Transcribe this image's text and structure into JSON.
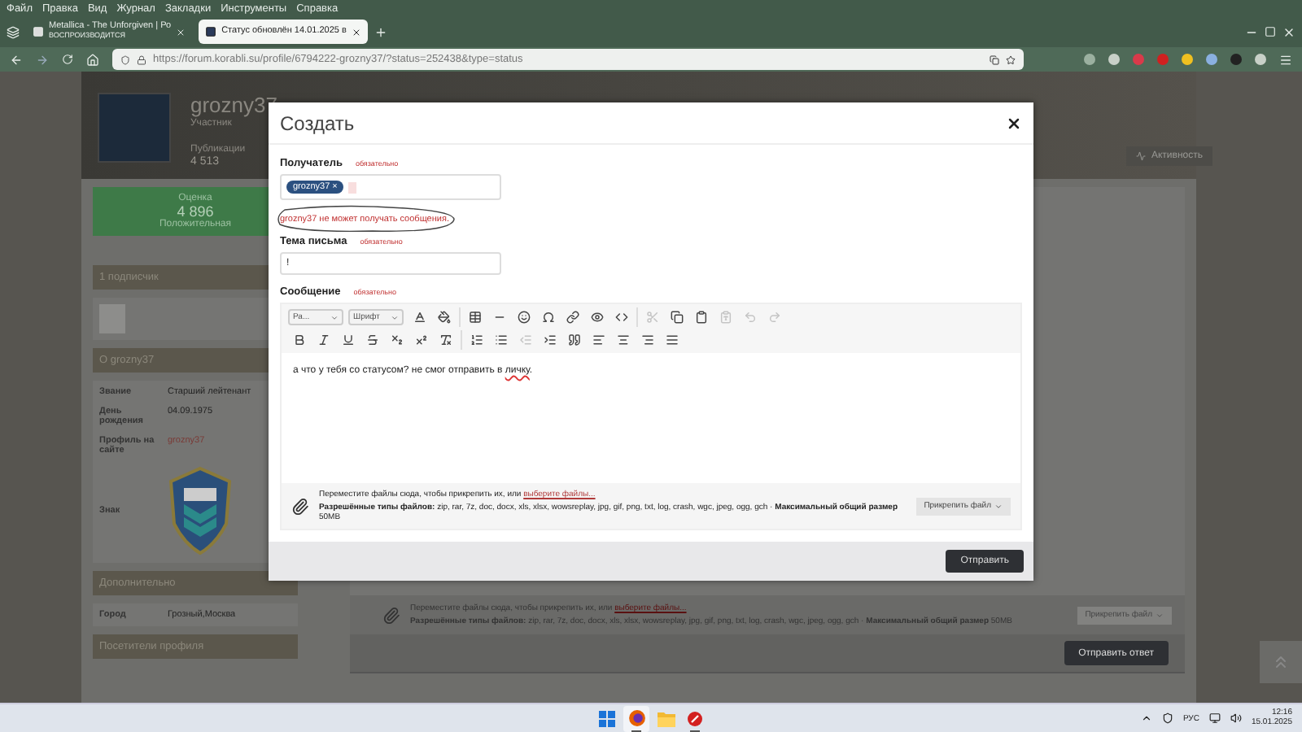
{
  "browser": {
    "menu": [
      "Файл",
      "Правка",
      "Вид",
      "Журнал",
      "Закладки",
      "Инструменты",
      "Справка"
    ],
    "tabs": [
      {
        "title": "Metallica - The Unforgiven | Ро",
        "subtitle": "ВОСПРОИЗВОДИТСЯ",
        "selected": false
      },
      {
        "title": "Статус обновлён 14.01.2025 в",
        "selected": true
      }
    ],
    "url": "https://forum.korabli.su/profile/6794222-grozny37/?status=252438&type=status"
  },
  "profile": {
    "name": "grozny37",
    "role": "Участник",
    "stat_label": "Публикации",
    "stat_value": "4 513",
    "reputation": {
      "label": "Оценка",
      "value": "4 896",
      "verdict": "Положительная"
    },
    "followers_title": "1 подписчик",
    "about_title": "О grozny37",
    "about": [
      {
        "kind": "text",
        "label": "Звание",
        "value": "Старший лейтенант"
      },
      {
        "kind": "text",
        "label": "День рождения",
        "value": "04.09.1975"
      },
      {
        "kind": "link",
        "label": "Профиль на сайте",
        "value": "grozny37"
      },
      {
        "kind": "badge",
        "label": "Знак"
      }
    ],
    "extra_title": "Дополнительно",
    "extra": [
      {
        "label": "Город",
        "value": "Грозный,Москва"
      }
    ],
    "visitors_title": "Посетители профиля",
    "activity_button": "Активность",
    "reply_attach": {
      "text": "Переместите файлы сюда, чтобы прикрепить их, или ",
      "link": "выберите файлы...",
      "types": "**Разрешённые типы файлов:** zip, rar, 7z, doc, docx, xls, xlsx, wowsreplay, jpg, gif, png, txt, log, crash, wgc, jpeg, ogg, gch · **Максимальный общий размер** 50MB",
      "button": "Прикрепить файл"
    },
    "reply_button": "Отправить ответ"
  },
  "modal": {
    "title": "Создать",
    "recipient": {
      "label": "Получатель",
      "required": "обязательно",
      "chip": "grozny37 ×",
      "error": "grozny37 не может получать сообщения."
    },
    "subject": {
      "label": "Тема письма",
      "required": "обязательно",
      "value": "!"
    },
    "message": {
      "label": "Сообщение",
      "required": "обязательно",
      "body": "а что у тебя со статусом? не смог отправить в ",
      "body_misspelled": "личку",
      "body_end": "."
    },
    "toolbar": [
      [
        [
          {
            "kind": "dropdown",
            "label": "Ра..."
          },
          {
            "kind": "dropdown",
            "label": "Шрифт"
          },
          {
            "kind": "text-color",
            "disabled": false
          },
          {
            "kind": "bg-color",
            "disabled": false
          }
        ],
        [
          {
            "kind": "table",
            "disabled": false
          },
          {
            "kind": "rule",
            "disabled": false
          },
          {
            "kind": "emoji",
            "disabled": false
          },
          {
            "kind": "omega",
            "disabled": false
          },
          {
            "kind": "link",
            "disabled": false
          },
          {
            "kind": "preview",
            "disabled": false
          },
          {
            "kind": "source",
            "disabled": false
          }
        ],
        [
          {
            "kind": "cut",
            "disabled": true
          },
          {
            "kind": "copy",
            "disabled": false
          },
          {
            "kind": "paste",
            "disabled": false
          },
          {
            "kind": "paste-text",
            "disabled": true
          },
          {
            "kind": "undo",
            "disabled": true
          },
          {
            "kind": "redo",
            "disabled": true
          }
        ]
      ],
      [
        [
          {
            "kind": "bold",
            "disabled": false
          },
          {
            "kind": "italic",
            "disabled": false
          },
          {
            "kind": "underline",
            "disabled": false
          },
          {
            "kind": "strike",
            "disabled": false
          },
          {
            "kind": "subscript",
            "disabled": false
          },
          {
            "kind": "superscript",
            "disabled": false
          },
          {
            "kind": "clear",
            "disabled": false
          }
        ],
        [
          {
            "kind": "numbered",
            "disabled": false
          },
          {
            "kind": "bulleted",
            "disabled": false
          },
          {
            "kind": "outdent",
            "disabled": true
          },
          {
            "kind": "indent",
            "disabled": false
          },
          {
            "kind": "quote",
            "disabled": false
          },
          {
            "kind": "align-left",
            "disabled": false
          },
          {
            "kind": "align-center",
            "disabled": false
          },
          {
            "kind": "align-right",
            "disabled": false
          },
          {
            "kind": "justify",
            "disabled": false
          }
        ]
      ]
    ],
    "attach": {
      "text": "Переместите файлы сюда, чтобы прикрепить их, или ",
      "link": "выберите файлы...",
      "types": "**Разрешённые типы файлов:** zip, rar, 7z, doc, docx, xls, xlsx, wowsreplay, jpg, gif, png, txt, log, crash, wgc, jpeg, ogg, gch · **Максимальный общий размер** 50MB",
      "button": "Прикрепить файл"
    },
    "submit": "Отправить"
  },
  "taskbar": {
    "apps": [
      {
        "kind": "windows",
        "selected": false,
        "running": false
      },
      {
        "kind": "firefox",
        "selected": true,
        "running": true
      },
      {
        "kind": "folder",
        "selected": false,
        "running": false
      },
      {
        "kind": "game",
        "selected": false,
        "running": true
      }
    ],
    "language": "РУС",
    "time": "12:16",
    "date": "15.01.2025"
  }
}
